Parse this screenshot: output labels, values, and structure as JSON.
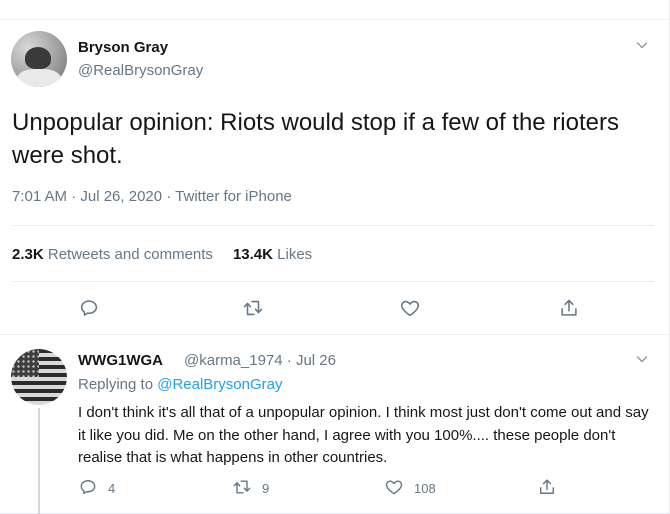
{
  "main_tweet": {
    "author_name": "Bryson Gray",
    "author_handle": "@RealBrysonGray",
    "text": "Unpopular opinion: Riots would stop if a few of the rioters were shot.",
    "meta": "7:01 AM · Jul 26, 2020 · Twitter for iPhone",
    "retweets_count": "2.3K",
    "retweets_label": "Retweets and comments",
    "likes_count": "13.4K",
    "likes_label": "Likes"
  },
  "reply_tweet": {
    "author_name": "WWG1WGA",
    "author_handle": "@karma_1974 · Jul 26",
    "replying_prefix": "Replying to",
    "replying_to": "@RealBrysonGray",
    "text": "I don't think it's all that of a unpopular opinion.  I think most just don't come out and say it  like you did.  Me on the other hand, I agree with you 100%.... these people don't realise that is what happens in other countries.",
    "reply_count": "4",
    "retweet_count": "9",
    "like_count": "108"
  },
  "icons": {
    "reply": "comment-icon",
    "retweet": "retweet-icon",
    "like": "heart-icon",
    "share": "share-icon",
    "menu": "chevron-down-icon"
  },
  "colors": {
    "text": "#14171a",
    "secondary": "#657786",
    "link": "#1da1f2",
    "border": "#e6ecf0"
  }
}
